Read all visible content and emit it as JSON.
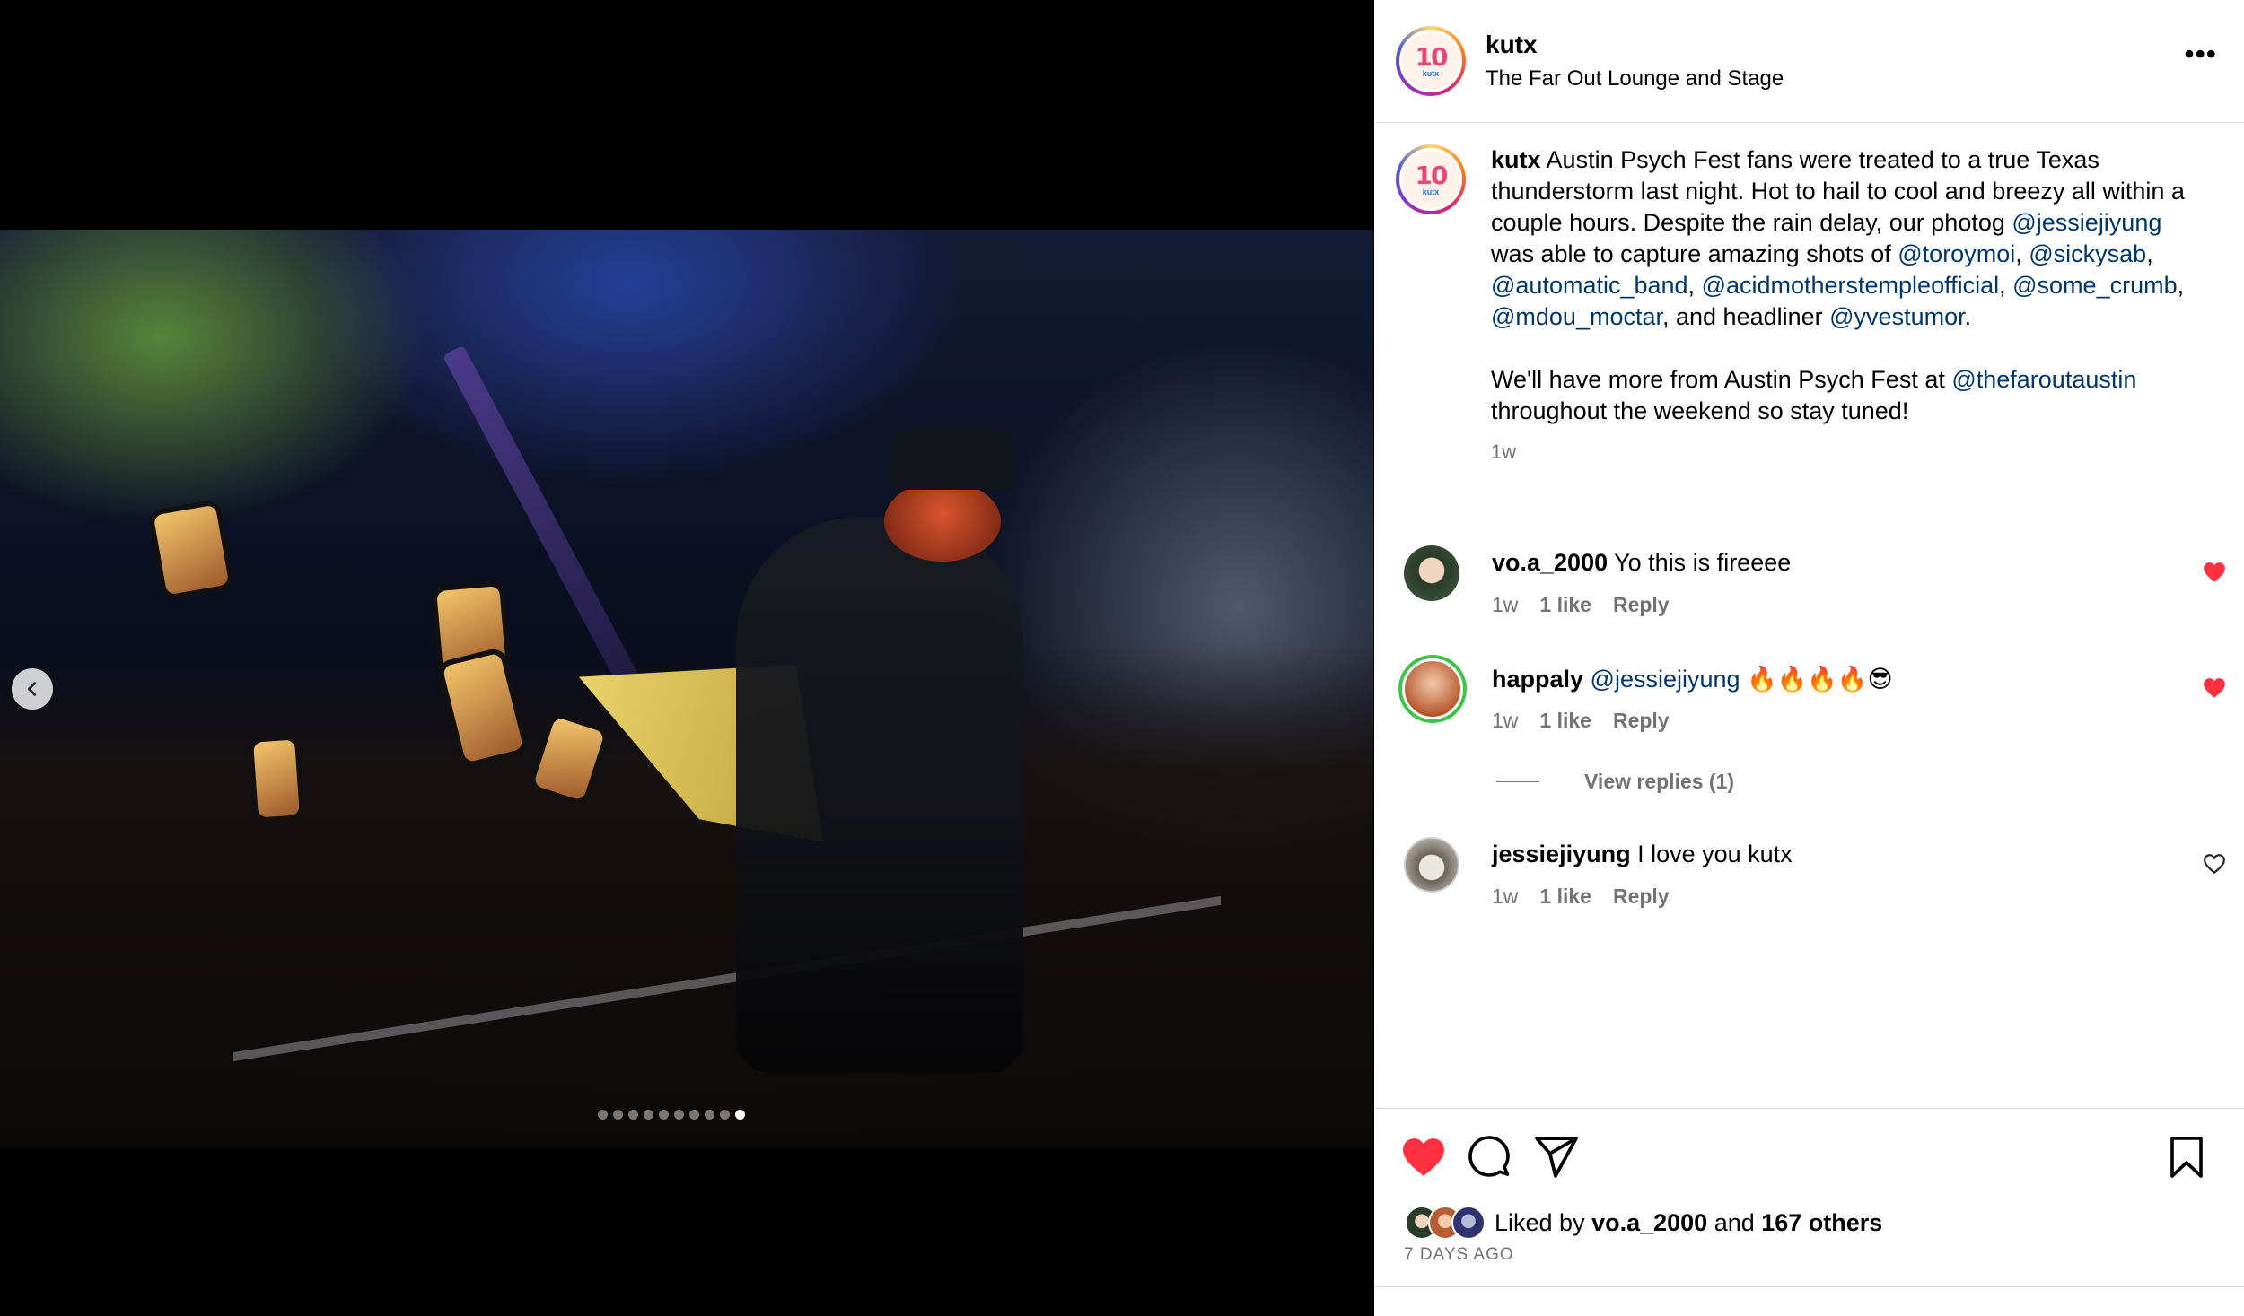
{
  "post": {
    "username": "kutx",
    "location": "The Far Out Lounge and Stage",
    "more_label": "•••",
    "logo_number": "10",
    "logo_word": "kutx"
  },
  "media": {
    "total_slides": 10,
    "active_slide": 10
  },
  "caption": {
    "username": "kutx",
    "text_1": " Austin Psych Fest fans were treated to a true Texas thunderstorm last night. Hot to hail to cool and breezy all within a couple hours. Despite the rain delay, our photog ",
    "mention_1": "@jessiejiyung",
    "text_2": " was able to capture amazing shots of ",
    "mention_2": "@toroymoi",
    "sep_2": ", ",
    "mention_3": "@sickysab",
    "sep_3": ", ",
    "mention_4": "@automatic_band",
    "sep_4": ", ",
    "mention_5": "@acidmotherstempleofficial",
    "sep_5": ", ",
    "mention_6": "@some_crumb",
    "sep_6": ", ",
    "mention_7": "@mdou_moctar",
    "text_3": ", and headliner ",
    "mention_8": "@yvestumor",
    "text_4": ".",
    "para2_text": "We'll have more from Austin Psych Fest at ",
    "para2_mention": "@thefaroutaustin",
    "para2_end": " throughout the weekend so stay tuned!",
    "time": "1w"
  },
  "comments": [
    {
      "username": "vo.a_2000",
      "text": " Yo this is fireeee",
      "time": "1w",
      "likes": "1 like",
      "reply": "Reply",
      "liked": true
    },
    {
      "username": "happaly",
      "mention": "@jessiejiyung",
      "text": " 🔥🔥🔥🔥😎",
      "time": "1w",
      "likes": "1 like",
      "reply": "Reply",
      "liked": true,
      "view_replies": "View replies (1)"
    },
    {
      "username": "jessiejiyung",
      "text": " I love you kutx",
      "time": "1w",
      "likes": "1 like",
      "reply": "Reply",
      "liked": false
    }
  ],
  "actions": {
    "liked_by_prefix": "Liked by ",
    "liked_by_user": "vo.a_2000",
    "liked_by_and": " and ",
    "liked_by_others": "167 others",
    "date": "7 DAYS AGO"
  },
  "colors": {
    "like_red": "#ff3040",
    "mention_blue": "#00376b",
    "muted": "#737373"
  },
  "icons": {
    "prev": "chevron-left-icon",
    "like": "heart-filled-icon",
    "comment": "comment-icon",
    "share": "paper-plane-icon",
    "save": "bookmark-icon"
  }
}
